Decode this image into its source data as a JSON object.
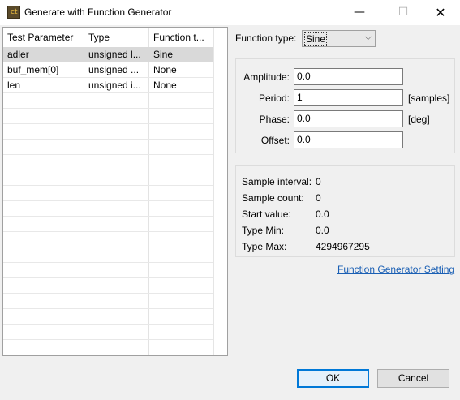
{
  "window": {
    "title": "Generate with Function Generator",
    "icon_text": "ct",
    "controls": {
      "minimize": "—",
      "maximize": "☐",
      "close": "✕"
    }
  },
  "table": {
    "headers": [
      "Test Parameter",
      "Type",
      "Function t..."
    ],
    "rows": [
      {
        "param": "adler",
        "type": "unsigned l...",
        "func": "Sine",
        "selected": true
      },
      {
        "param": "buf_mem[0]",
        "type": "unsigned ...",
        "func": "None",
        "selected": false
      },
      {
        "param": "len",
        "type": "unsigned i...",
        "func": "None",
        "selected": false
      }
    ]
  },
  "function_type": {
    "label": "Function type:",
    "selected": "Sine",
    "chevron": "⌵"
  },
  "params": {
    "amplitude": {
      "label": "Amplitude:",
      "value": "0.0",
      "unit": ""
    },
    "period": {
      "label": "Period:",
      "value": "1",
      "unit": "[samples]"
    },
    "phase": {
      "label": "Phase:",
      "value": "0.0",
      "unit": "[deg]"
    },
    "offset": {
      "label": "Offset:",
      "value": "0.0",
      "unit": ""
    }
  },
  "info": {
    "sample_interval": {
      "label": "Sample interval:",
      "value": "0"
    },
    "sample_count": {
      "label": "Sample count:",
      "value": "0"
    },
    "start_value": {
      "label": "Start value:",
      "value": "0.0"
    },
    "type_min": {
      "label": "Type Min:",
      "value": "0.0"
    },
    "type_max": {
      "label": "Type Max:",
      "value": "4294967295"
    }
  },
  "link": {
    "label": "Function Generator Setting"
  },
  "buttons": {
    "ok": "OK",
    "cancel": "Cancel"
  },
  "colors": {
    "link": "#1a5fb4",
    "selected_row": "#d9d9d9",
    "ok_border": "#0078d7"
  }
}
